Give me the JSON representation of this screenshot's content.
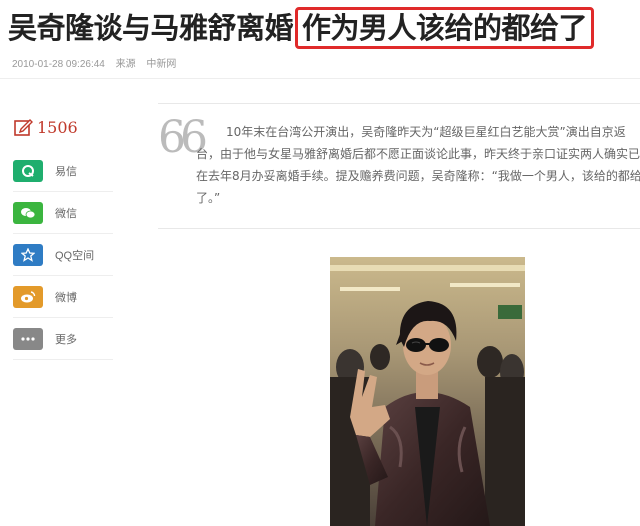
{
  "article": {
    "title_prefix": "吴奇隆谈与马雅舒离婚",
    "title_highlight": "作为男人该给的都给了",
    "date": "2010-01-28 09:26:44",
    "source_label": "来源",
    "source": "中新网",
    "quote": "10年末在台湾公开演出，吴奇隆昨天为“超级巨星红白艺能大赏”演出自京返台，由于他与女星马雅舒离婚后都不愿正面谈论此事，昨天终于亲口证实两人确实已在去年8月办妥离婚手续。提及赡养费问题，吴奇隆称：“我做一个男人，该给的都给了。”",
    "quote_mark": "66"
  },
  "share": {
    "count": "1506",
    "items": [
      {
        "label": "易信",
        "color": "#1fae6e",
        "icon": "yixin-icon"
      },
      {
        "label": "微信",
        "color": "#3bb53f",
        "icon": "wechat-icon"
      },
      {
        "label": "QQ空间",
        "color": "#2f7cc4",
        "icon": "qzone-icon"
      },
      {
        "label": "微博",
        "color": "#e39a2a",
        "icon": "weibo-icon"
      },
      {
        "label": "更多",
        "color": "#888888",
        "icon": "more-icon"
      }
    ]
  },
  "colors": {
    "highlight_border": "#e02a2a",
    "share_count": "#c0392b"
  }
}
